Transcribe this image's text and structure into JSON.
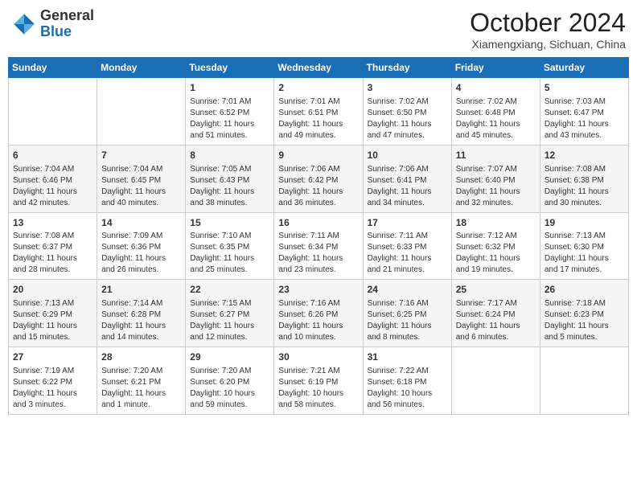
{
  "logo": {
    "general": "General",
    "blue": "Blue"
  },
  "title": {
    "month": "October 2024",
    "location": "Xiamengxiang, Sichuan, China"
  },
  "weekdays": [
    "Sunday",
    "Monday",
    "Tuesday",
    "Wednesday",
    "Thursday",
    "Friday",
    "Saturday"
  ],
  "weeks": [
    [
      null,
      null,
      {
        "day": "1",
        "sunrise": "7:01 AM",
        "sunset": "6:52 PM",
        "daylight": "11 hours and 51 minutes."
      },
      {
        "day": "2",
        "sunrise": "7:01 AM",
        "sunset": "6:51 PM",
        "daylight": "11 hours and 49 minutes."
      },
      {
        "day": "3",
        "sunrise": "7:02 AM",
        "sunset": "6:50 PM",
        "daylight": "11 hours and 47 minutes."
      },
      {
        "day": "4",
        "sunrise": "7:02 AM",
        "sunset": "6:48 PM",
        "daylight": "11 hours and 45 minutes."
      },
      {
        "day": "5",
        "sunrise": "7:03 AM",
        "sunset": "6:47 PM",
        "daylight": "11 hours and 43 minutes."
      }
    ],
    [
      {
        "day": "6",
        "sunrise": "7:04 AM",
        "sunset": "6:46 PM",
        "daylight": "11 hours and 42 minutes."
      },
      {
        "day": "7",
        "sunrise": "7:04 AM",
        "sunset": "6:45 PM",
        "daylight": "11 hours and 40 minutes."
      },
      {
        "day": "8",
        "sunrise": "7:05 AM",
        "sunset": "6:43 PM",
        "daylight": "11 hours and 38 minutes."
      },
      {
        "day": "9",
        "sunrise": "7:06 AM",
        "sunset": "6:42 PM",
        "daylight": "11 hours and 36 minutes."
      },
      {
        "day": "10",
        "sunrise": "7:06 AM",
        "sunset": "6:41 PM",
        "daylight": "11 hours and 34 minutes."
      },
      {
        "day": "11",
        "sunrise": "7:07 AM",
        "sunset": "6:40 PM",
        "daylight": "11 hours and 32 minutes."
      },
      {
        "day": "12",
        "sunrise": "7:08 AM",
        "sunset": "6:38 PM",
        "daylight": "11 hours and 30 minutes."
      }
    ],
    [
      {
        "day": "13",
        "sunrise": "7:08 AM",
        "sunset": "6:37 PM",
        "daylight": "11 hours and 28 minutes."
      },
      {
        "day": "14",
        "sunrise": "7:09 AM",
        "sunset": "6:36 PM",
        "daylight": "11 hours and 26 minutes."
      },
      {
        "day": "15",
        "sunrise": "7:10 AM",
        "sunset": "6:35 PM",
        "daylight": "11 hours and 25 minutes."
      },
      {
        "day": "16",
        "sunrise": "7:11 AM",
        "sunset": "6:34 PM",
        "daylight": "11 hours and 23 minutes."
      },
      {
        "day": "17",
        "sunrise": "7:11 AM",
        "sunset": "6:33 PM",
        "daylight": "11 hours and 21 minutes."
      },
      {
        "day": "18",
        "sunrise": "7:12 AM",
        "sunset": "6:32 PM",
        "daylight": "11 hours and 19 minutes."
      },
      {
        "day": "19",
        "sunrise": "7:13 AM",
        "sunset": "6:30 PM",
        "daylight": "11 hours and 17 minutes."
      }
    ],
    [
      {
        "day": "20",
        "sunrise": "7:13 AM",
        "sunset": "6:29 PM",
        "daylight": "11 hours and 15 minutes."
      },
      {
        "day": "21",
        "sunrise": "7:14 AM",
        "sunset": "6:28 PM",
        "daylight": "11 hours and 14 minutes."
      },
      {
        "day": "22",
        "sunrise": "7:15 AM",
        "sunset": "6:27 PM",
        "daylight": "11 hours and 12 minutes."
      },
      {
        "day": "23",
        "sunrise": "7:16 AM",
        "sunset": "6:26 PM",
        "daylight": "11 hours and 10 minutes."
      },
      {
        "day": "24",
        "sunrise": "7:16 AM",
        "sunset": "6:25 PM",
        "daylight": "11 hours and 8 minutes."
      },
      {
        "day": "25",
        "sunrise": "7:17 AM",
        "sunset": "6:24 PM",
        "daylight": "11 hours and 6 minutes."
      },
      {
        "day": "26",
        "sunrise": "7:18 AM",
        "sunset": "6:23 PM",
        "daylight": "11 hours and 5 minutes."
      }
    ],
    [
      {
        "day": "27",
        "sunrise": "7:19 AM",
        "sunset": "6:22 PM",
        "daylight": "11 hours and 3 minutes."
      },
      {
        "day": "28",
        "sunrise": "7:20 AM",
        "sunset": "6:21 PM",
        "daylight": "11 hours and 1 minute."
      },
      {
        "day": "29",
        "sunrise": "7:20 AM",
        "sunset": "6:20 PM",
        "daylight": "10 hours and 59 minutes."
      },
      {
        "day": "30",
        "sunrise": "7:21 AM",
        "sunset": "6:19 PM",
        "daylight": "10 hours and 58 minutes."
      },
      {
        "day": "31",
        "sunrise": "7:22 AM",
        "sunset": "6:18 PM",
        "daylight": "10 hours and 56 minutes."
      },
      null,
      null
    ]
  ]
}
